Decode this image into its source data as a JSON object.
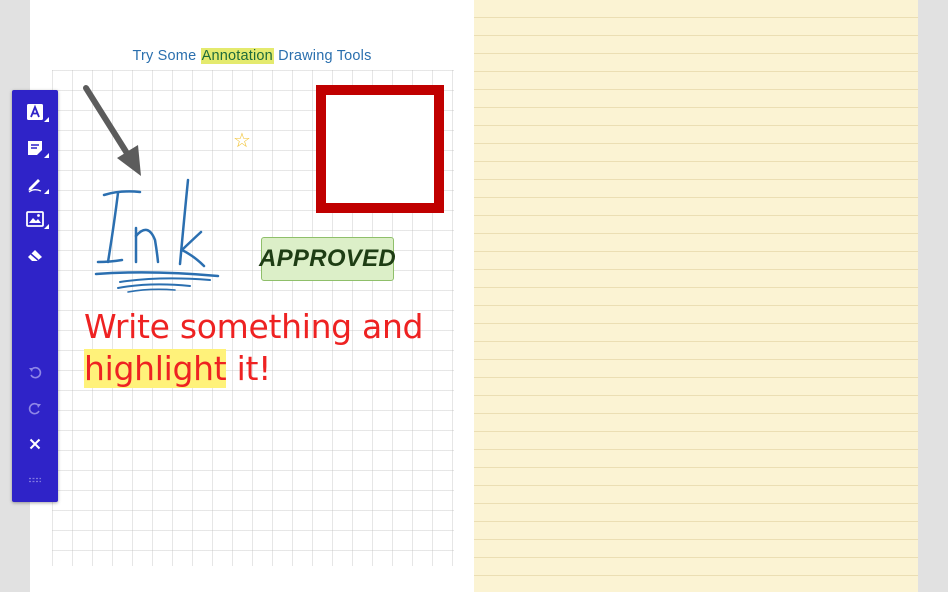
{
  "page": {
    "title_before": "Try Some ",
    "title_highlight": "Annotation",
    "title_after": " Drawing Tools"
  },
  "annotations": {
    "stamp_text": "APPROVED",
    "line1": "Write something and",
    "line2_highlight": "highlight",
    "line2_after": " it!",
    "star_glyph": "☆",
    "ink_word": "Ink"
  },
  "toolbar": {
    "tools": [
      "text-tool",
      "note-tool",
      "pen-tool",
      "image-tool",
      "eraser-tool"
    ],
    "actions": [
      "undo",
      "redo",
      "close",
      "more"
    ]
  },
  "colors": {
    "toolbar": "#2f23c8",
    "red_text": "#ee2222",
    "highlight": "#fff27a",
    "ink_blue": "#2b6fb0",
    "square_red": "#c00000",
    "stamp_bg": "#dcefc8"
  }
}
